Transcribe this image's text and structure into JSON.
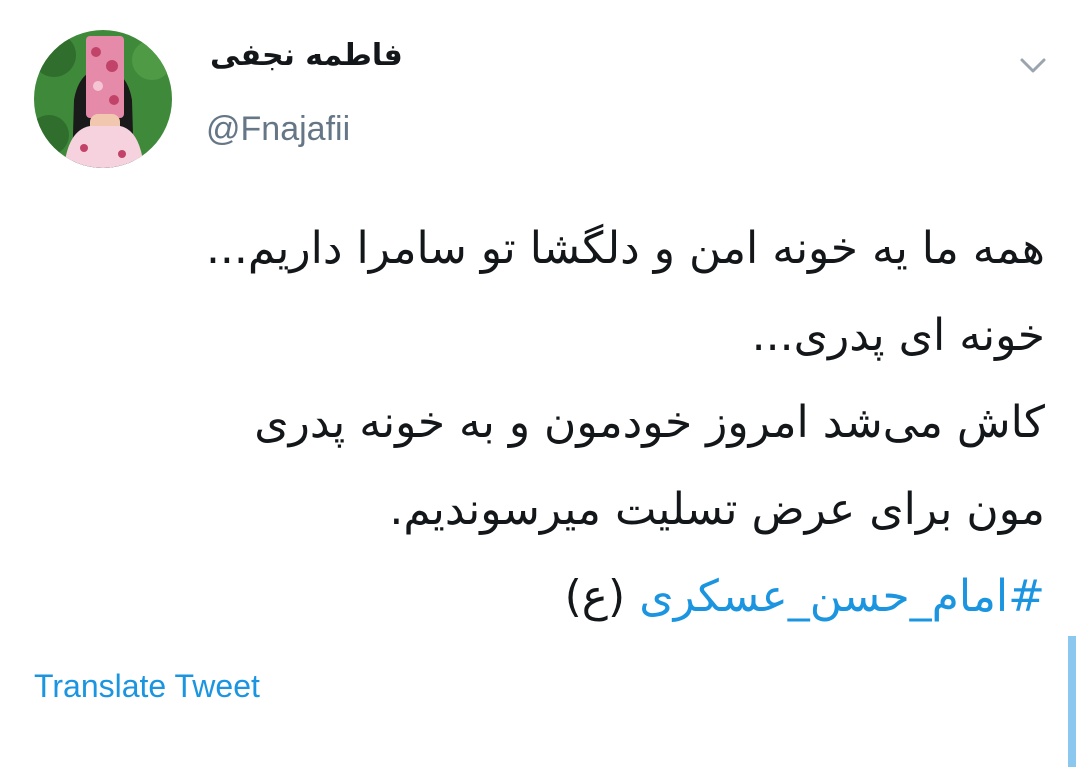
{
  "user": {
    "display_name": "فاطمه نجفی",
    "handle": "@Fnajafii"
  },
  "tweet": {
    "lines": [
      "همه ما یه خونه امن و دلگشا تو سامرا داریم...",
      "خونه ای پدری...",
      "کاش می‌شد امروز خودمون و به خونه پدری",
      "مون برای عرض تسلیت میرسوندیم."
    ],
    "hashtag": "#امام_حسن_عسکری",
    "suffix": " (ع)"
  },
  "actions": {
    "translate_label": "Translate Tweet"
  },
  "icons": {
    "menu": "chevron-down-icon"
  },
  "colors": {
    "link": "#1b95e0",
    "text": "#14171a",
    "secondary": "#657786"
  }
}
